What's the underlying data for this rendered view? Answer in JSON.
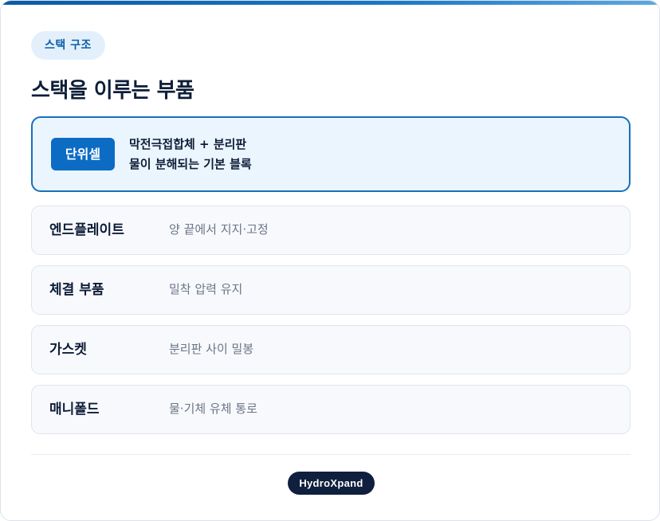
{
  "section": {
    "tag": "스택 구조",
    "title": "스택을 이루는 부품"
  },
  "hero": {
    "badge": "단위셀",
    "line1": "막전극접합체 + 분리판",
    "line2": "물이 분해되는 기본 블록"
  },
  "components": [
    {
      "name": "엔드플레이트",
      "desc": "양 끝에서 지지·고정"
    },
    {
      "name": "체결 부품",
      "desc": "밀착 압력 유지"
    },
    {
      "name": "가스켓",
      "desc": "분리판 사이 밀봉"
    },
    {
      "name": "매니폴드",
      "desc": "물·기체 유체 통로"
    }
  ],
  "footer": {
    "brand": "HydroXpand"
  },
  "colors": {
    "accent": "#0c6cc4",
    "hero_background": "#eaf5fd",
    "title_text": "#0e1d38",
    "muted_text": "#6b7587",
    "brand_pill": "#0f1f3d"
  }
}
